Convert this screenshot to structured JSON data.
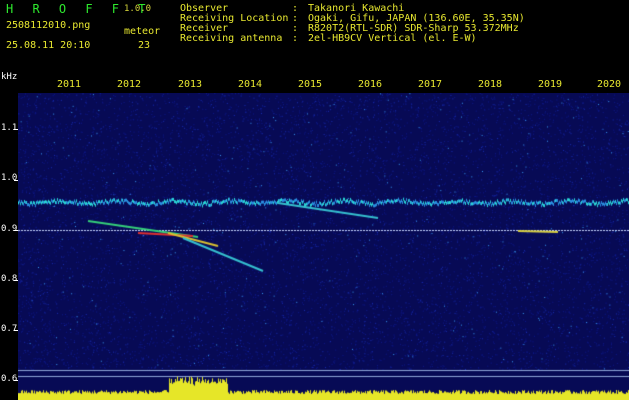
{
  "header": {
    "app_title": "H R O F F T",
    "app_version": "1.0.0",
    "file_name": "2508112010.png",
    "meteor_label": "meteor",
    "date_time": "25.08.11 20:10",
    "meteor_count": "23",
    "info": [
      {
        "key": "Observer",
        "value": "Takanori Kawachi"
      },
      {
        "key": "Receiving Location",
        "value": "Ogaki, Gifu, JAPAN (136.60E, 35.35N)"
      },
      {
        "key": "Receiver",
        "value": "R820T2(RTL-SDR) SDR-Sharp 53.372MHz"
      },
      {
        "key": "Receiving antenna",
        "value": "2el-HB9CV Vertical (el. E-W)"
      }
    ]
  },
  "axis": {
    "unit": "kHz",
    "y_labels": [
      "1.1",
      "1.0",
      "0.9",
      "0.8",
      "0.7",
      "0.6"
    ],
    "x_labels": [
      "2011",
      "2012",
      "2013",
      "2014",
      "2015",
      "2016",
      "2017",
      "2018",
      "2019",
      "2020"
    ]
  },
  "colors": {
    "background": "#000000",
    "spectrogram_base": "#0b0f6e",
    "header_text": "#e8e830",
    "title_green": "#2ee92e"
  }
}
